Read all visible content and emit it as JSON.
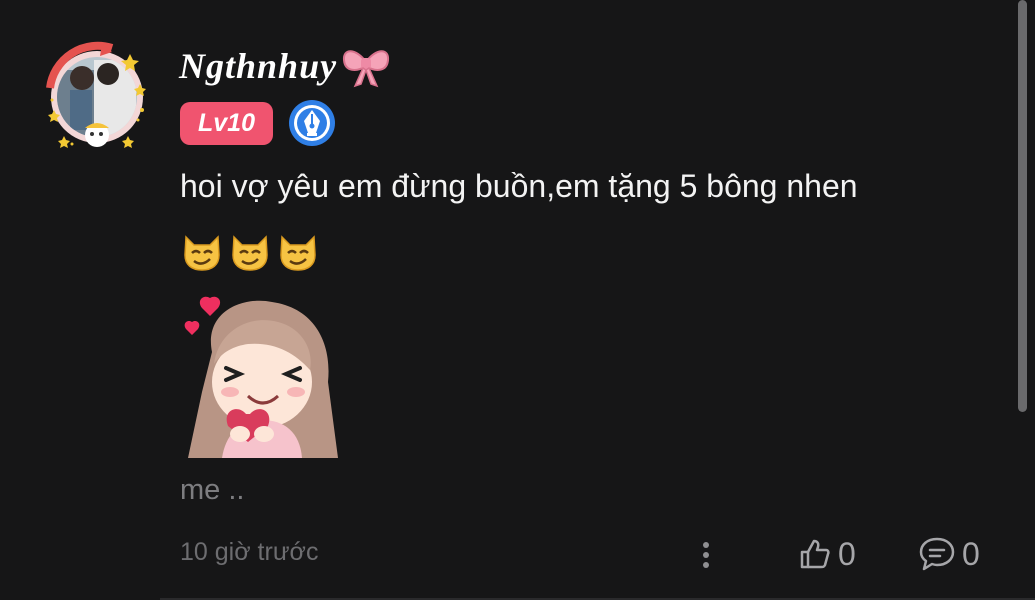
{
  "comment": {
    "username": "Ngthnhuy",
    "level": "Lv10",
    "text": "hoi vợ yêu em đừng buồn,em tặng 5 bông nhen",
    "caption": "me ..",
    "timestamp": "10 giờ trước",
    "likes": "0",
    "replies": "0"
  },
  "icons": {
    "avatar": "avatar-frame-stars",
    "username_decoration": "pink-bow-icon",
    "badge": "pen-nib-badge-icon",
    "emojis": [
      "smirking-cat-icon",
      "smirking-cat-icon",
      "smirking-cat-icon"
    ],
    "sticker": "girl-holding-heart-sticker",
    "more": "more-vertical-icon",
    "like": "thumbs-up-icon",
    "reply": "speech-bubble-icon"
  },
  "colors": {
    "background": "#161617",
    "level_badge": "#f0546f",
    "badge_blue": "#2f7fe6",
    "muted_text": "#6d6d70"
  }
}
